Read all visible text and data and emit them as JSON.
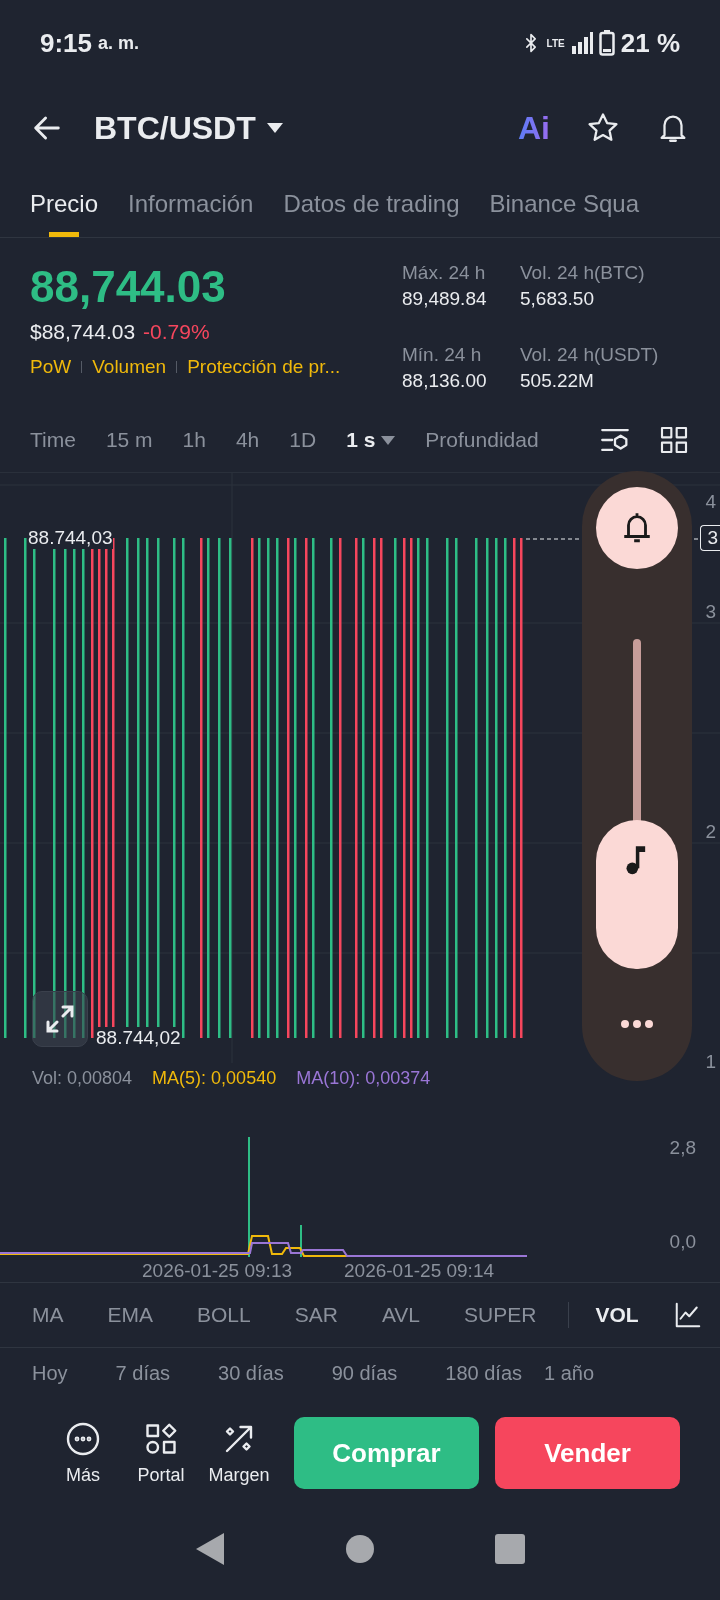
{
  "status_bar": {
    "time": "9:15",
    "ampm": "a. m.",
    "network": "LTE",
    "battery": "21 %"
  },
  "header": {
    "pair": "BTC/USDT",
    "ai_badge": "Ai"
  },
  "tabs": [
    {
      "label": "Precio",
      "selected": true
    },
    {
      "label": "Información",
      "selected": false
    },
    {
      "label": "Datos de trading",
      "selected": false
    },
    {
      "label": "Binance Squa",
      "selected": false
    }
  ],
  "ticker": {
    "last_price": "88,744.03",
    "usd_price": "$88,744.03",
    "change": "-0.79%",
    "tags": [
      "PoW",
      "Volumen",
      "Protección de pr..."
    ],
    "stats": [
      {
        "label": "Máx. 24 h",
        "value": "89,489.84"
      },
      {
        "label": "Vol. 24 h(BTC)",
        "value": "5,683.50"
      },
      {
        "label": "Mín. 24 h",
        "value": "88,136.00"
      },
      {
        "label": "Vol. 24 h(USDT)",
        "value": "505.22M"
      }
    ]
  },
  "intervals": [
    {
      "label": "Time",
      "selected": false
    },
    {
      "label": "15 m",
      "selected": false
    },
    {
      "label": "1h",
      "selected": false
    },
    {
      "label": "4h",
      "selected": false
    },
    {
      "label": "1D",
      "selected": false
    },
    {
      "label": "1 s",
      "selected": true
    },
    {
      "label": "Profundidad",
      "selected": false
    }
  ],
  "chart": {
    "high_label": "88.744,03",
    "low_label": "88.744,02",
    "price_tag": "3",
    "axis_labels": [
      "4",
      "3",
      "2",
      "1"
    ]
  },
  "volume_panel": {
    "level": 0.42
  },
  "volume": {
    "vol": "Vol: 0,00804",
    "ma5": "MA(5): 0,00540",
    "ma10": "MA(10): 0,00374",
    "y_labels": [
      "2,8",
      "0,0"
    ],
    "times": [
      "2026-01-25 09:13",
      "2026-01-25 09:14"
    ]
  },
  "indicators": [
    {
      "label": "MA",
      "selected": false
    },
    {
      "label": "EMA",
      "selected": false
    },
    {
      "label": "BOLL",
      "selected": false
    },
    {
      "label": "SAR",
      "selected": false
    },
    {
      "label": "AVL",
      "selected": false
    },
    {
      "label": "SUPER",
      "selected": false
    },
    {
      "label": "VOL",
      "selected": true
    }
  ],
  "periods": [
    "Hoy",
    "7 días",
    "30 días",
    "90 días",
    "180 días",
    "1 año"
  ],
  "actions": [
    {
      "kind": "more",
      "label": "Más"
    },
    {
      "kind": "portal",
      "label": "Portal"
    },
    {
      "kind": "margin",
      "label": "Margen"
    }
  ],
  "buy": "Comprar",
  "sell": "Vender"
}
